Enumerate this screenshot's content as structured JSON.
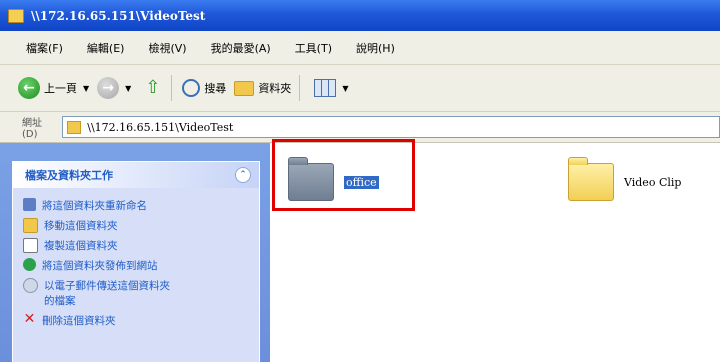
{
  "window": {
    "title": "\\\\172.16.65.151\\VideoTest"
  },
  "menu": [
    "檔案(F)",
    "編輯(E)",
    "檢視(V)",
    "我的最愛(A)",
    "工具(T)",
    "說明(H)"
  ],
  "toolbar": {
    "back_label": "上一頁",
    "search_label": "搜尋",
    "folders_label": "資料夾"
  },
  "address": {
    "label": "網址(D)",
    "value": "\\\\172.16.65.151\\VideoTest"
  },
  "taskpane": {
    "title": "檔案及資料夾工作",
    "tasks": [
      "將這個資料夾重新命名",
      "移動這個資料夾",
      "複製這個資料夾",
      "將這個資料夾發佈到網站",
      "以電子郵件傳送這個資料夾的檔案",
      "刪除這個資料夾"
    ]
  },
  "content": {
    "items": [
      {
        "name": "office",
        "selected": true
      },
      {
        "name": "Video Clip",
        "selected": false
      }
    ]
  },
  "colors": {
    "highlight_box": "#e00000",
    "titlebar": "#1f58d8",
    "task_link": "#215dc6"
  }
}
